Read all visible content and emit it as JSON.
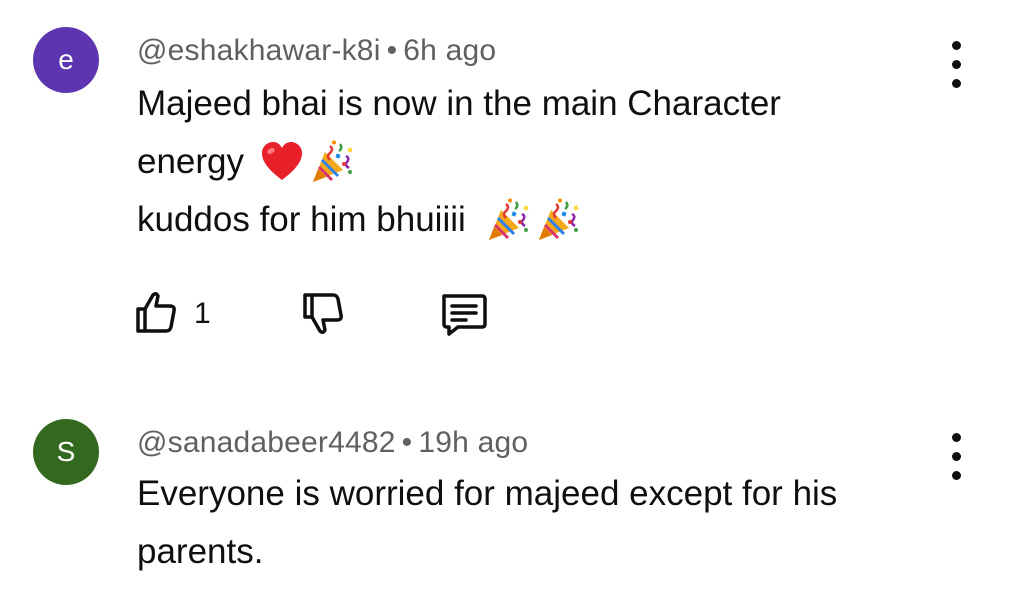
{
  "comments": [
    {
      "avatar_letter": "e",
      "avatar_color": "#5e35b1",
      "username": "@eshakhawar-k8i",
      "separator": "•",
      "time": "6h ago",
      "lines": [
        "Majeed bhai is now in the main Character",
        "energy",
        "kuddos for him bhuiiii"
      ],
      "emojis_line2": [
        "red-heart-emoji",
        "party-popper-emoji"
      ],
      "emojis_line3": [
        "party-popper-emoji",
        "party-popper-emoji"
      ],
      "like_count": "1",
      "icons": {
        "like": "thumbs-up-icon",
        "dislike": "thumbs-down-icon",
        "reply": "reply-comment-icon",
        "menu": "more-vert-icon"
      }
    },
    {
      "avatar_letter": "S",
      "avatar_color": "#33691e",
      "username": "@sanadabeer4482",
      "separator": "•",
      "time": "19h ago",
      "lines": [
        "Everyone is worried for majeed except for his",
        "parents."
      ],
      "icons": {
        "menu": "more-vert-icon"
      }
    }
  ]
}
